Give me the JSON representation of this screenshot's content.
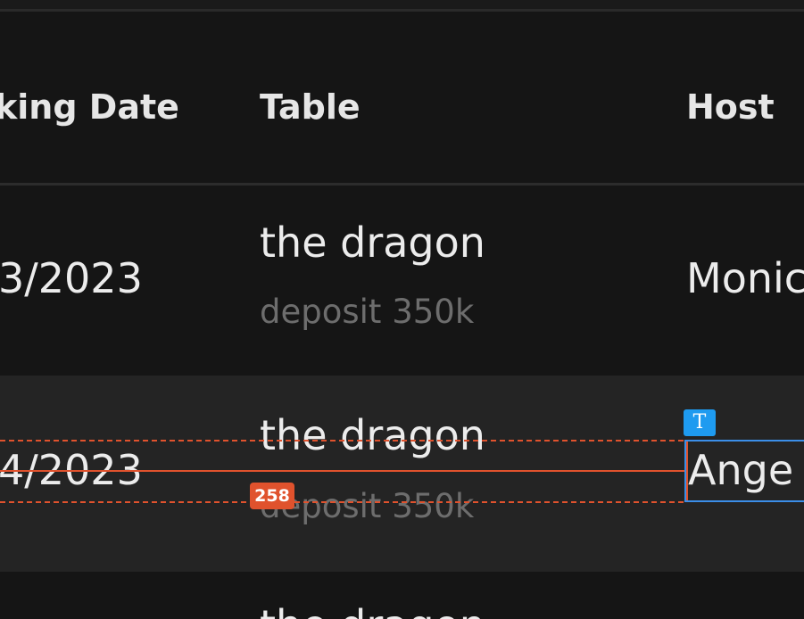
{
  "table": {
    "headers": {
      "booking_date": "king Date",
      "table": "Table",
      "host": "Host"
    },
    "rows": [
      {
        "date": "3/2023",
        "table_name": "the dragon",
        "deposit": "deposit 350k",
        "host": "Monic"
      },
      {
        "date": "4/2023",
        "table_name": "the dragon",
        "deposit": "deposit 350k",
        "host": "Ange"
      },
      {
        "table_name": "the dragon"
      }
    ]
  },
  "overlay": {
    "measure_value": "258",
    "text_tool_badge": "T",
    "accent_color": "#e0522d",
    "selection_color": "#3b8ee8"
  }
}
